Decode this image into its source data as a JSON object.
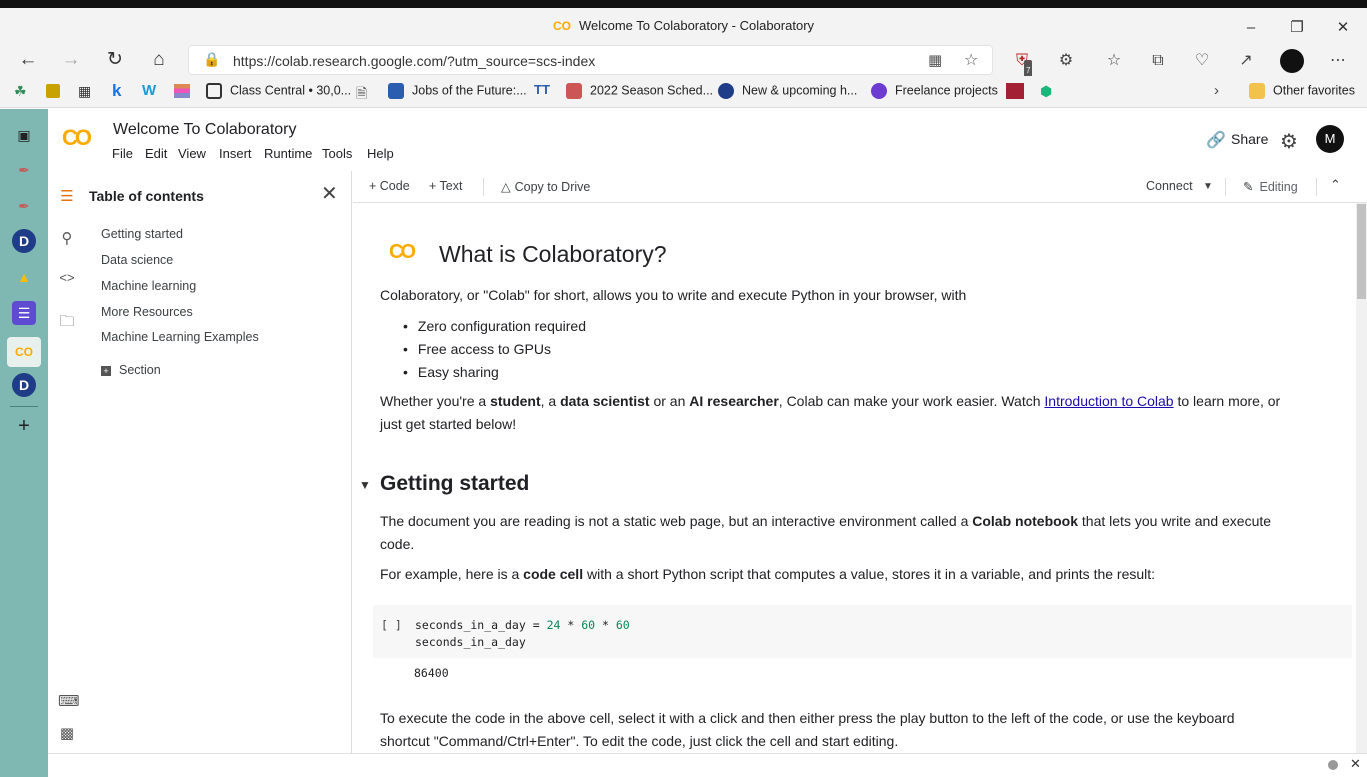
{
  "browser": {
    "tab_title": "Welcome To Colaboratory - Colaboratory",
    "url": "https://colab.research.google.com/?utm_source=scs-index",
    "favorites": [
      {
        "label": "Class Central • 30,0...",
        "color": "#333"
      },
      {
        "label": "Jobs of the Future:...",
        "color": "#2a5db0"
      },
      {
        "label": "2022 Season Sched...",
        "color": "#c55"
      },
      {
        "label": "New & upcoming h...",
        "color": "#1f3c88"
      },
      {
        "label": "Freelance projects",
        "color": "#6c3bd1"
      }
    ],
    "other_favorites": "Other favorites",
    "ext_badge": "7"
  },
  "colab": {
    "logo": "CO",
    "notebook_title": "Welcome To Colaboratory",
    "menu": [
      "File",
      "Edit",
      "View",
      "Insert",
      "Runtime",
      "Tools",
      "Help"
    ],
    "share_label": "Share",
    "avatar_initial": "M"
  },
  "toc": {
    "title": "Table of contents",
    "items": [
      "Getting started",
      "Data science",
      "Machine learning",
      "More Resources",
      "Machine Learning Examples"
    ],
    "section_label": "Section"
  },
  "toolbar": {
    "code_label": "+ Code",
    "text_label": "+ Text",
    "copy_label": "Copy to Drive",
    "connect_label": "Connect",
    "editing_label": "Editing"
  },
  "notebook": {
    "heading": "What is Colaboratory?",
    "intro": "Colaboratory, or \"Colab\" for short, allows you to write and execute Python in your browser, with",
    "bullets": [
      "Zero configuration required",
      "Free access to GPUs",
      "Easy sharing"
    ],
    "audience_1": "Whether you're a ",
    "audience_student": "student",
    "audience_2": ", a ",
    "audience_ds": "data scientist",
    "audience_3": " or an ",
    "audience_ai": "AI researcher",
    "audience_4": ", Colab can make your work easier. Watch ",
    "audience_link": "Introduction to Colab",
    "audience_5": " to learn more, or",
    "audience_6": "just get started below!",
    "section_heading": "Getting started",
    "doc_1": "The document you are reading is not a static web page, but an interactive environment called a ",
    "doc_bold": "Colab notebook",
    "doc_2": " that lets you write and execute",
    "doc_3": "code.",
    "example_1": "For example, here is a ",
    "example_bold": "code cell",
    "example_2": " with a short Python script that computes a value, stores it in a variable, and prints the result:",
    "cell_bracket": "[ ]",
    "code_var": "seconds_in_a_day = ",
    "code_n1": "24",
    "code_op1": " * ",
    "code_n2": "60",
    "code_op2": " * ",
    "code_n3": "60",
    "code_line2": "seconds_in_a_day",
    "output": "86400",
    "exec_1": "To execute the code in the above cell, select it with a click and then either press the play button to the left of the code, or use the keyboard",
    "exec_2": "shortcut \"Command/Ctrl+Enter\". To edit the code, just click the cell and start editing."
  }
}
